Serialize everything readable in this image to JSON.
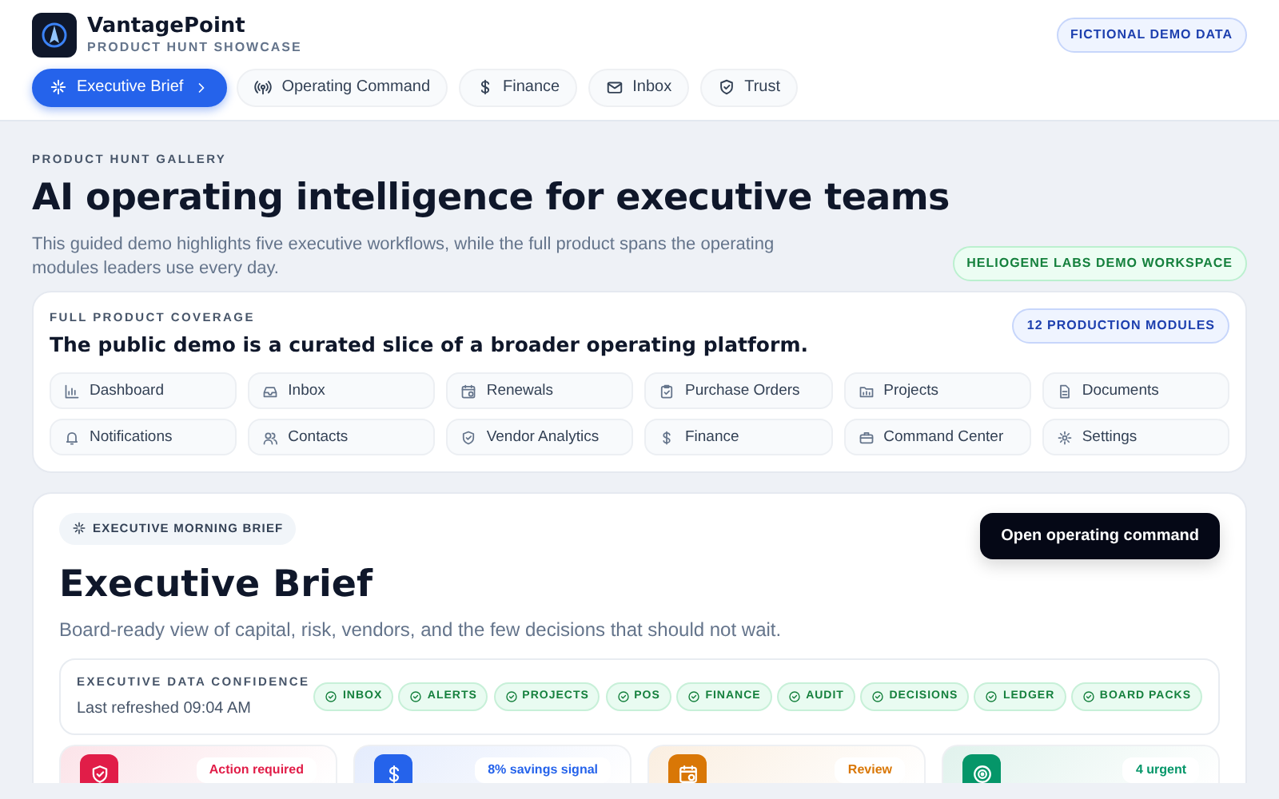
{
  "brand": {
    "name": "VantagePoint",
    "subtitle": "PRODUCT HUNT SHOWCASE"
  },
  "demo_badge": "FICTIONAL DEMO DATA",
  "nav": [
    {
      "label": "Executive Brief",
      "selected": true
    },
    {
      "label": "Operating Command",
      "selected": false
    },
    {
      "label": "Finance",
      "selected": false
    },
    {
      "label": "Inbox",
      "selected": false
    },
    {
      "label": "Trust",
      "selected": false
    }
  ],
  "hero": {
    "eyebrow": "PRODUCT HUNT GALLERY",
    "title": "AI operating intelligence for executive teams",
    "description": "This guided demo highlights five executive workflows, while the full product spans the operating modules leaders use every day.",
    "workspace_badge": "HELIOGENE LABS DEMO WORKSPACE"
  },
  "coverage": {
    "eyebrow": "FULL PRODUCT COVERAGE",
    "title": "The public demo is a curated slice of a broader operating platform.",
    "badge": "12 PRODUCTION MODULES",
    "modules": [
      "Dashboard",
      "Inbox",
      "Renewals",
      "Purchase Orders",
      "Projects",
      "Documents",
      "Notifications",
      "Contacts",
      "Vendor Analytics",
      "Finance",
      "Command Center",
      "Settings"
    ]
  },
  "brief": {
    "eyebrow": "EXECUTIVE MORNING BRIEF",
    "title": "Executive Brief",
    "description": "Board-ready view of capital, risk, vendors, and the few decisions that should not wait.",
    "button": "Open operating command",
    "confidence": {
      "title": "EXECUTIVE DATA CONFIDENCE",
      "refreshed": "Last refreshed 09:04 AM",
      "sources": [
        "INBOX",
        "ALERTS",
        "PROJECTS",
        "POS",
        "FINANCE",
        "AUDIT",
        "DECISIONS",
        "LEDGER",
        "BOARD PACKS"
      ]
    },
    "cards": [
      {
        "badge": "Action required",
        "color": "#e11d48"
      },
      {
        "badge": "8% savings signal",
        "color": "#2563eb"
      },
      {
        "badge": "Review",
        "color": "#d97706"
      },
      {
        "badge": "4 urgent",
        "color": "#059669"
      }
    ]
  }
}
